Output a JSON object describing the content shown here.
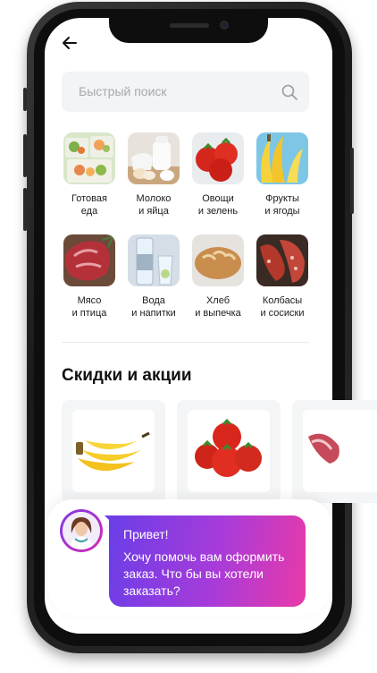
{
  "header": {
    "back_icon": "arrow-left-icon"
  },
  "search": {
    "placeholder": "Быстрый поиск",
    "icon": "search-icon"
  },
  "categories": [
    {
      "line1": "Готовая",
      "line2": "еда",
      "icon": "ready-food-image"
    },
    {
      "line1": "Молоко",
      "line2": "и яйца",
      "icon": "milk-eggs-image"
    },
    {
      "line1": "Овощи",
      "line2": "и зелень",
      "icon": "vegetables-image"
    },
    {
      "line1": "Фрукты",
      "line2": "и ягоды",
      "icon": "fruits-image"
    },
    {
      "line1": "Мясо",
      "line2": "и птица",
      "icon": "meat-image"
    },
    {
      "line1": "Вода",
      "line2": "и напитки",
      "icon": "water-image"
    },
    {
      "line1": "Хлеб",
      "line2": "и выпечка",
      "icon": "bread-image"
    },
    {
      "line1": "Колбасы",
      "line2": "и сосиски",
      "icon": "sausages-image"
    }
  ],
  "promo": {
    "title": "Скидки и акции",
    "cards": [
      {
        "icon": "bananas-image"
      },
      {
        "icon": "tomatoes-image"
      },
      {
        "icon": "meat-image"
      }
    ]
  },
  "chat": {
    "greeting": "Привет!",
    "message": "Хочу помочь вам оформить заказ. Что бы вы хотели заказать?"
  },
  "colors": {
    "bubble_gradient_start": "#6a3ee8",
    "bubble_gradient_end": "#e93aa8",
    "search_bg": "#f3f4f5",
    "card_bg": "#f4f5f6"
  }
}
